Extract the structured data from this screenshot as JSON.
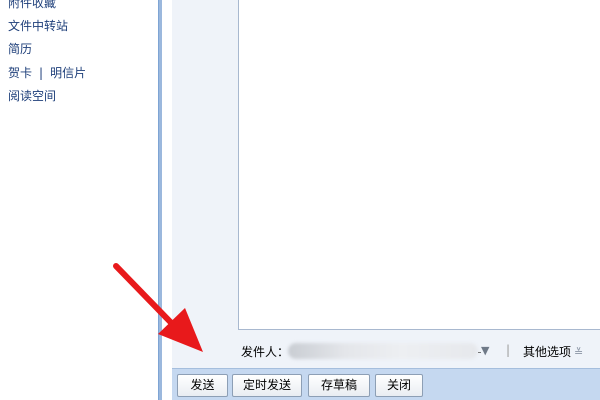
{
  "sidebar": {
    "items": [
      {
        "label": "附件收藏"
      },
      {
        "label": "文件中转站"
      },
      {
        "label": "简历"
      },
      {
        "label": "贺卡"
      },
      {
        "label": "明信片"
      },
      {
        "label": "阅读空间"
      }
    ],
    "separator": "|"
  },
  "sender": {
    "label": "发件人：",
    "dropdown_icon": "▼",
    "separator": "|",
    "other_options_label": "其他选项",
    "other_options_icon": "chevron-double-down-icon",
    "other_options_glyph": "≚"
  },
  "toolbar": {
    "send_label": "发送",
    "scheduled_send_label": "定时发送",
    "save_draft_label": "存草稿",
    "close_label": "关闭"
  },
  "colors": {
    "link": "#1e3f7a",
    "toolbar_bg": "#c5d8f0",
    "arrow": "#e8191b"
  }
}
